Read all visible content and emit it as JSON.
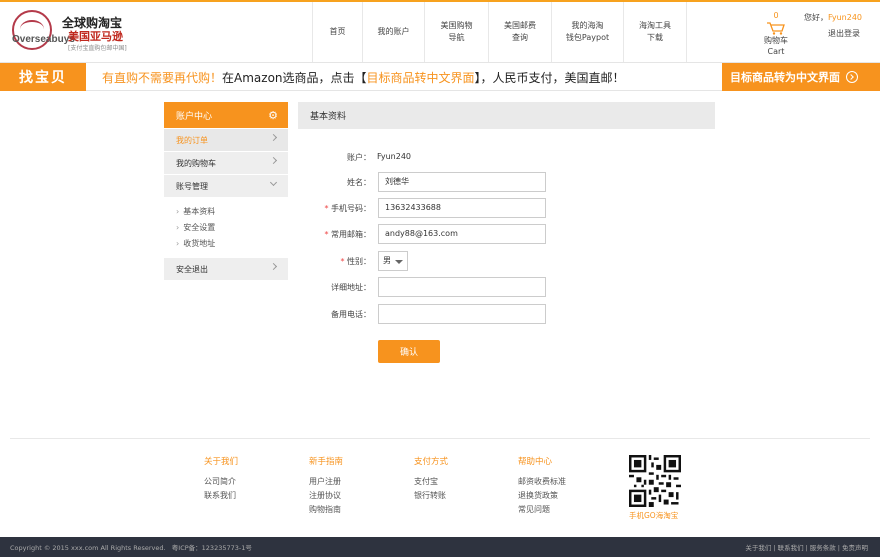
{
  "logo": {
    "en": "Overseabuys",
    "en_sub": ".com",
    "cn1": "全球购淘宝",
    "cn2": "美国亚马逊",
    "cn3": "[支付宝直购包邮中国]"
  },
  "nav": [
    {
      "lines": [
        "首页"
      ],
      "active": true
    },
    {
      "lines": [
        "我的账户"
      ],
      "active": false
    },
    {
      "lines": [
        "美国购物",
        "导航"
      ],
      "active": false
    },
    {
      "lines": [
        "美国邮费",
        "查询"
      ],
      "active": false
    },
    {
      "lines": [
        "我的海淘",
        "钱包Paypot"
      ],
      "active": false
    },
    {
      "lines": [
        "海淘工具",
        "下载"
      ],
      "active": false
    }
  ],
  "cart": {
    "count": "0",
    "label": "购物车",
    "label_en": "Cart"
  },
  "user": {
    "greeting": "您好，",
    "name": "Fyun240",
    "logout": "退出登录"
  },
  "banner": {
    "left": "找宝贝",
    "text_a": "有直购不需要再代购！",
    "text_b": "在Amazon选商品，点击【",
    "text_c": "目标商品转中文界面",
    "text_d": "】，人民币支付，美国直邮！",
    "right": "目标商品转为中文界面"
  },
  "sidebar": {
    "title": "账户中心",
    "items": [
      {
        "label": "我的订单",
        "active": true
      },
      {
        "label": "我的购物车",
        "active": false
      },
      {
        "label": "账号管理",
        "active": false
      }
    ],
    "sub_items": [
      "基本资料",
      "安全设置",
      "收货地址"
    ],
    "logout": "安全退出"
  },
  "main": {
    "title": "基本资料",
    "account_label": "账户：",
    "account_value": "Fyun240",
    "fields": [
      {
        "label": "姓名：",
        "required": false,
        "value": "刘德华"
      },
      {
        "label": "手机号码：",
        "required": true,
        "value": "13632433688"
      },
      {
        "label": "常用邮箱：",
        "required": true,
        "value": "andy88@163.com"
      }
    ],
    "gender_label": "性别：",
    "gender_value": "男",
    "address_label": "详细地址：",
    "address_value": "",
    "phone_label": "备用电话：",
    "phone_value": "",
    "confirm": "确认"
  },
  "footer": {
    "cols": [
      {
        "title": "关于我们",
        "items": [
          "公司简介",
          "联系我们"
        ]
      },
      {
        "title": "新手指南",
        "items": [
          "用户注册",
          "注册协议",
          "购物指南"
        ]
      },
      {
        "title": "支付方式",
        "items": [
          "支付宝",
          "银行转账"
        ]
      },
      {
        "title": "帮助中心",
        "items": [
          "邮资收费标准",
          "退换货政策",
          "常见问题"
        ]
      }
    ],
    "qr_label": "手机GO海淘宝",
    "copyright": "Copyright © 2015 xxx.com All Rights Reserved.",
    "icp": "粤ICP备：123235773-1号",
    "links": [
      "关于我们",
      "联系我们",
      "服务条款",
      "免责声明"
    ]
  },
  "colors": {
    "accent": "#f7931e",
    "bottom_bar": "#2e333f"
  }
}
